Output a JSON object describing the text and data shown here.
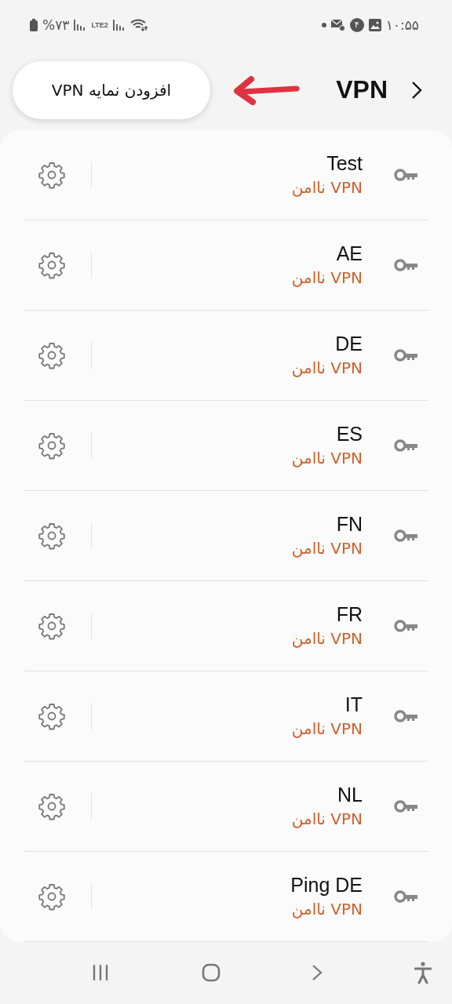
{
  "status_bar": {
    "time": "۱۰:۵۵",
    "notification_badge": "۴",
    "battery": "%۷۳",
    "network": "LTE2"
  },
  "header": {
    "title": "VPN",
    "add_button": "افزودن نمایه VPN"
  },
  "profiles": [
    {
      "name": "Test",
      "status": "VPN ناامن"
    },
    {
      "name": "AE",
      "status": "VPN ناامن"
    },
    {
      "name": "DE",
      "status": "VPN ناامن"
    },
    {
      "name": "ES",
      "status": "VPN ناامن"
    },
    {
      "name": "FN",
      "status": "VPN ناامن"
    },
    {
      "name": "FR",
      "status": "VPN ناامن"
    },
    {
      "name": "IT",
      "status": "VPN ناامن"
    },
    {
      "name": "NL",
      "status": "VPN ناامن"
    },
    {
      "name": "Ping DE",
      "status": "VPN ناامن"
    }
  ]
}
